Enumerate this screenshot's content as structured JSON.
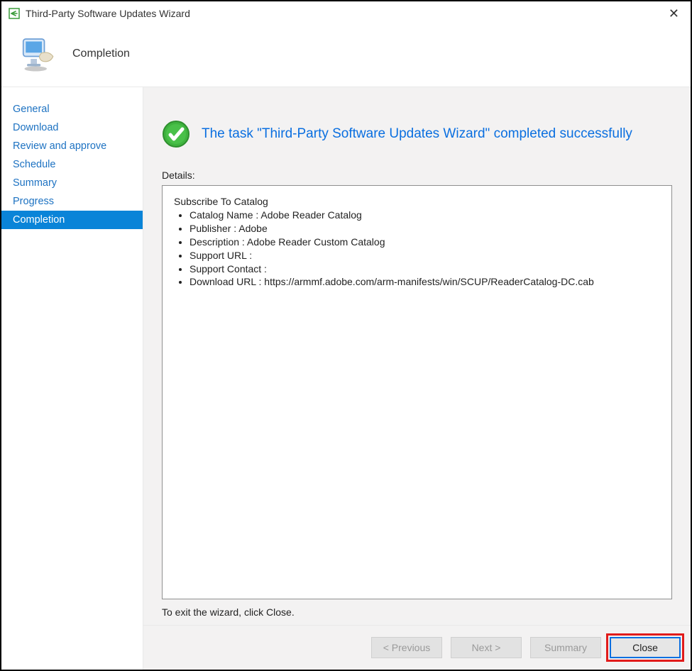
{
  "titlebar": {
    "title": "Third-Party Software Updates Wizard"
  },
  "header": {
    "title": "Completion"
  },
  "sidebar": {
    "items": [
      {
        "label": "General"
      },
      {
        "label": "Download"
      },
      {
        "label": "Review and approve"
      },
      {
        "label": "Schedule"
      },
      {
        "label": "Summary"
      },
      {
        "label": "Progress"
      },
      {
        "label": "Completion",
        "selected": true
      }
    ]
  },
  "content": {
    "success_text": "The task \"Third-Party Software Updates Wizard\" completed successfully",
    "details_label": "Details:",
    "details_root": "Subscribe To Catalog",
    "detail_items": [
      "Catalog Name : Adobe Reader Catalog",
      "Publisher : Adobe",
      "Description : Adobe Reader Custom Catalog",
      "Support URL :",
      "Support Contact :",
      "Download URL : https://armmf.adobe.com/arm-manifests/win/SCUP/ReaderCatalog-DC.cab"
    ],
    "exit_hint": "To exit the wizard, click Close."
  },
  "footer": {
    "previous": "<  Previous",
    "next": "Next  >",
    "summary": "Summary",
    "close": "Close"
  }
}
